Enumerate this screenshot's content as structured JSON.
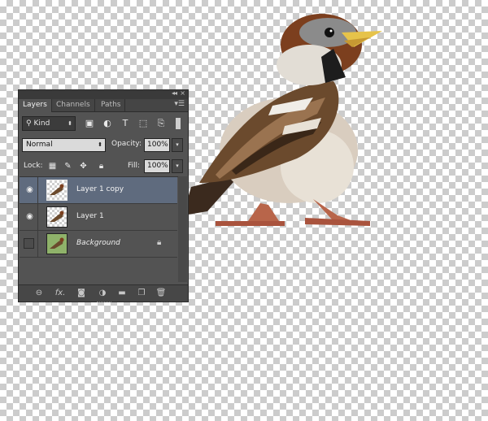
{
  "panel": {
    "tabs": [
      {
        "label": "Layers"
      },
      {
        "label": "Channels"
      },
      {
        "label": "Paths"
      }
    ],
    "filter": {
      "kind_label": "Kind"
    },
    "blend_mode": "Normal",
    "opacity": {
      "label": "Opacity:",
      "value": "100%"
    },
    "lock_label": "Lock:",
    "fill": {
      "label": "Fill:",
      "value": "100%"
    },
    "layers": [
      {
        "name": "Layer 1 copy",
        "visible": true,
        "selected": true
      },
      {
        "name": "Layer 1",
        "visible": true,
        "selected": false
      },
      {
        "name": "Background",
        "visible": false,
        "selected": false,
        "locked": true
      }
    ],
    "footer_icons": [
      "link-icon",
      "fx-icon",
      "add-mask-icon",
      "adjustment-layer-icon",
      "group-folder-icon",
      "new-layer-icon",
      "trash-icon"
    ]
  },
  "colors": {
    "panel_bg": "#535353",
    "selected_row": "#5f6b7e"
  }
}
